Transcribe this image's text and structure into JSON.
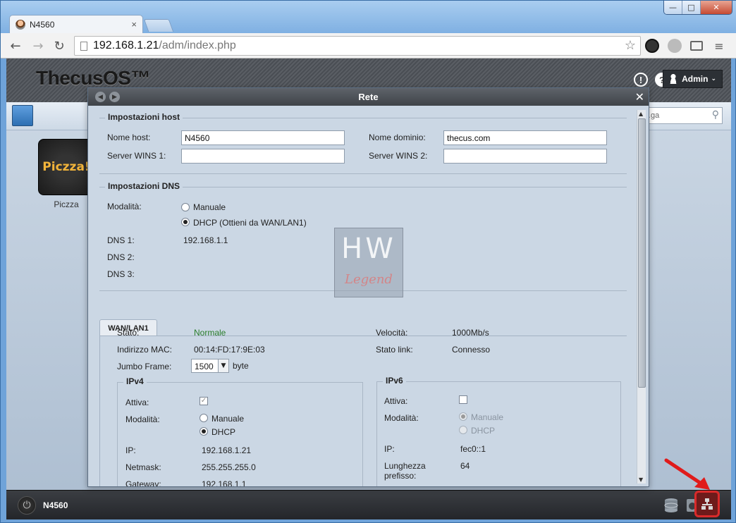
{
  "browser": {
    "tab_title": "N4560",
    "url_host": "192.168.1.21",
    "url_path": "/adm/index.php",
    "win_controls": [
      "—",
      "□",
      "✕"
    ]
  },
  "os": {
    "logo": "ThecusOS™",
    "admin_label": "Admin",
    "search_placeholder": "…ga",
    "app_tile_text": "Piczza!",
    "app_label": "Piczza",
    "taskbar_host": "N4560"
  },
  "dialog": {
    "title": "Rete",
    "host_section": {
      "legend": "Impostazioni host",
      "hostname_label": "Nome host:",
      "hostname_value": "N4560",
      "domain_label": "Nome dominio:",
      "domain_value": "thecus.com",
      "wins1_label": "Server WINS 1:",
      "wins1_value": "",
      "wins2_label": "Server WINS 2:",
      "wins2_value": ""
    },
    "dns_section": {
      "legend": "Impostazioni DNS",
      "mode_label": "Modalità:",
      "mode_manual": "Manuale",
      "mode_dhcp": "DHCP (Ottieni da WAN/LAN1)",
      "dns1_label": "DNS 1:",
      "dns1_value": "192.168.1.1",
      "dns2_label": "DNS 2:",
      "dns3_label": "DNS 3:"
    },
    "lan_tab": {
      "label": "WAN/LAN1",
      "status_label": "Stato:",
      "status_value": "Normale",
      "speed_label": "Velocità:",
      "speed_value": "1000Mb/s",
      "mac_label": "Indirizzo MAC:",
      "mac_value": "00:14:FD:17:9E:03",
      "link_label": "Stato link:",
      "link_value": "Connesso",
      "jumbo_label": "Jumbo Frame:",
      "jumbo_value": "1500",
      "jumbo_unit": "byte",
      "ipv4": {
        "legend": "IPv4",
        "active_label": "Attiva:",
        "mode_label": "Modalità:",
        "mode_manual": "Manuale",
        "mode_dhcp": "DHCP",
        "ip_label": "IP:",
        "ip_value": "192.168.1.21",
        "netmask_label": "Netmask:",
        "netmask_value": "255.255.255.0",
        "gateway_label": "Gateway:",
        "gateway_value": "192.168.1.1"
      },
      "ipv6": {
        "legend": "IPv6",
        "active_label": "Attiva:",
        "mode_label": "Modalità:",
        "mode_manual": "Manuale",
        "mode_dhcp": "DHCP",
        "ip_label": "IP:",
        "ip_value": "fec0::1",
        "prefix_label": "Lunghezza prefisso:",
        "prefix_value": "64"
      }
    }
  },
  "watermark": {
    "line1": "HW",
    "line2": "Legend"
  },
  "colors": {
    "status_ok": "#2a7d2a",
    "annotation_red": "#d92a2a"
  }
}
